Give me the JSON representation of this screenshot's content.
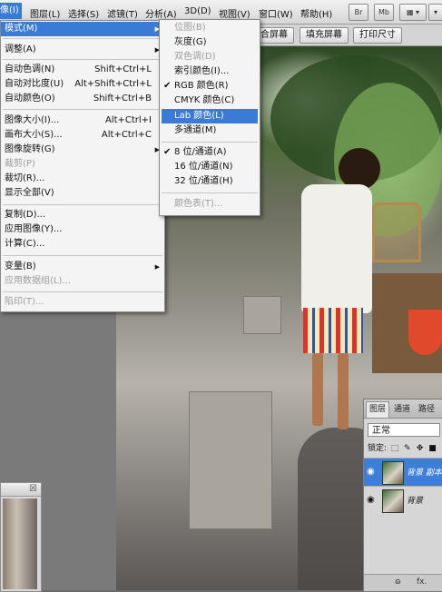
{
  "menubar": {
    "items": [
      "像(I)",
      "图层(L)",
      "选择(S)",
      "滤镜(T)",
      "分析(A)",
      "3D(D)",
      "视图(V)",
      "窗口(W)",
      "帮助(H)"
    ],
    "buttons": [
      "Br",
      "Mb"
    ]
  },
  "options_bar": {
    "buttons": [
      "合屏幕",
      "填充屏幕",
      "打印尺寸"
    ]
  },
  "image_menu": {
    "items": [
      {
        "label": "模式(M)",
        "shortcut": "",
        "submenu": true,
        "disabled": false,
        "highlighted": true
      },
      {
        "label": "调整(A)",
        "shortcut": "",
        "submenu": true,
        "disabled": false
      },
      {
        "label": "自动色调(N)",
        "shortcut": "Shift+Ctrl+L",
        "disabled": false
      },
      {
        "label": "自动对比度(U)",
        "shortcut": "Alt+Shift+Ctrl+L",
        "disabled": false
      },
      {
        "label": "自动颜色(O)",
        "shortcut": "Shift+Ctrl+B",
        "disabled": false
      },
      {
        "label": "图像大小(I)...",
        "shortcut": "Alt+Ctrl+I",
        "disabled": false
      },
      {
        "label": "画布大小(S)...",
        "shortcut": "Alt+Ctrl+C",
        "disabled": false
      },
      {
        "label": "图像旋转(G)",
        "shortcut": "",
        "submenu": true,
        "disabled": false
      },
      {
        "label": "裁剪(P)",
        "shortcut": "",
        "disabled": true
      },
      {
        "label": "裁切(R)...",
        "shortcut": "",
        "disabled": false
      },
      {
        "label": "显示全部(V)",
        "shortcut": "",
        "disabled": false
      },
      {
        "label": "复制(D)...",
        "shortcut": "",
        "disabled": false
      },
      {
        "label": "应用图像(Y)...",
        "shortcut": "",
        "disabled": false
      },
      {
        "label": "计算(C)...",
        "shortcut": "",
        "disabled": false
      },
      {
        "label": "变量(B)",
        "shortcut": "",
        "submenu": true,
        "disabled": false
      },
      {
        "label": "应用数据组(L)...",
        "shortcut": "",
        "disabled": true
      },
      {
        "label": "陷印(T)...",
        "shortcut": "",
        "disabled": true
      }
    ]
  },
  "mode_submenu": {
    "items": [
      {
        "label": "位图(B)",
        "checked": false,
        "disabled": true
      },
      {
        "label": "灰度(G)",
        "checked": false,
        "disabled": false
      },
      {
        "label": "双色调(D)",
        "checked": false,
        "disabled": true
      },
      {
        "label": "索引颜色(I)...",
        "checked": false,
        "disabled": false
      },
      {
        "label": "RGB 颜色(R)",
        "checked": true,
        "disabled": false
      },
      {
        "label": "CMYK 颜色(C)",
        "checked": false,
        "disabled": false
      },
      {
        "label": "Lab 颜色(L)",
        "checked": false,
        "disabled": false,
        "highlighted": true
      },
      {
        "label": "多通道(M)",
        "checked": false,
        "disabled": false
      },
      {
        "label": "8 位/通道(A)",
        "checked": true,
        "disabled": false
      },
      {
        "label": "16 位/通道(N)",
        "checked": false,
        "disabled": false
      },
      {
        "label": "32 位/通道(H)",
        "checked": false,
        "disabled": false
      },
      {
        "label": "颜色表(T)...",
        "checked": false,
        "disabled": true
      }
    ]
  },
  "layers_panel": {
    "tabs": [
      "图层",
      "通道",
      "路径"
    ],
    "blend_mode": "正常",
    "lock_label": "锁定:",
    "layers": [
      {
        "name": "背景 副本",
        "selected": true,
        "visible": true
      },
      {
        "name": "背景",
        "selected": false,
        "visible": true
      }
    ],
    "footer": [
      "ɷ",
      "fx."
    ]
  },
  "colors": {
    "highlight": "#3a7bd5",
    "menu_bg": "#f4f4f4",
    "disabled_text": "#9d9d9d"
  }
}
